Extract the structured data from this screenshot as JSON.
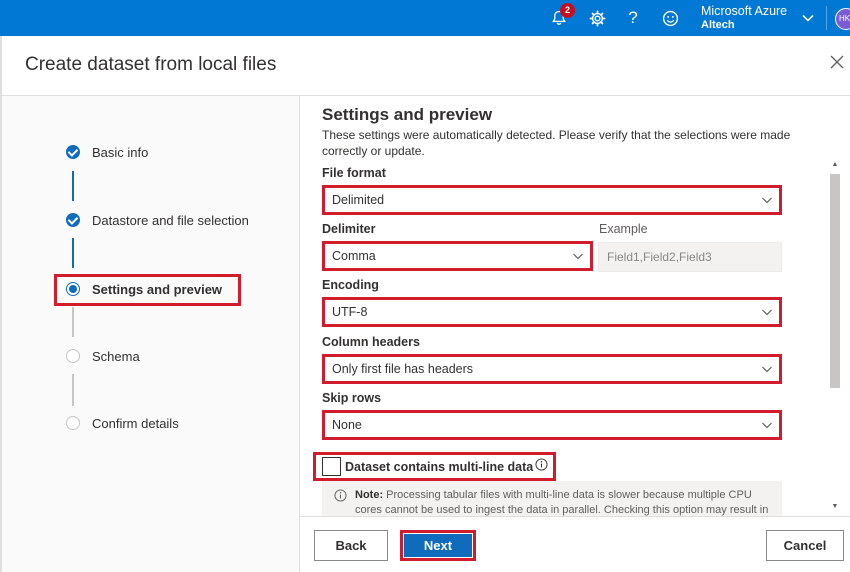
{
  "topbar": {
    "notification_count": "2",
    "account_name": "Microsoft Azure",
    "account_org": "Altech",
    "avatar_initials": "HK",
    "icons": [
      "bell-icon",
      "gear-icon",
      "help-icon",
      "feedback-icon",
      "chevron-down-icon"
    ]
  },
  "dialog": {
    "title": "Create dataset from local files"
  },
  "steps": [
    {
      "label": "Basic info",
      "state": "done"
    },
    {
      "label": "Datastore and file selection",
      "state": "done"
    },
    {
      "label": "Settings and preview",
      "state": "current"
    },
    {
      "label": "Schema",
      "state": "todo"
    },
    {
      "label": "Confirm details",
      "state": "todo"
    }
  ],
  "settings": {
    "title": "Settings and preview",
    "description": "These settings were automatically detected. Please verify that the selections were made correctly or update.",
    "file_format": {
      "label": "File format",
      "value": "Delimited"
    },
    "delimiter": {
      "label": "Delimiter",
      "value": "Comma"
    },
    "example": {
      "label": "Example",
      "value": "Field1,Field2,Field3"
    },
    "encoding": {
      "label": "Encoding",
      "value": "UTF-8"
    },
    "column_headers": {
      "label": "Column headers",
      "value": "Only first file has headers"
    },
    "skip_rows": {
      "label": "Skip rows",
      "value": "None"
    },
    "multiline": {
      "label": "Dataset contains multi-line data",
      "checked": false
    },
    "note": {
      "prefix": "Note:",
      "text": " Processing tabular files with multi-line data is slower because multiple CPU cores cannot be used to ingest the data in parallel. Checking this option may result in"
    }
  },
  "footer": {
    "back_label": "Back",
    "next_label": "Next",
    "cancel_label": "Cancel"
  },
  "colors": {
    "azure_blue": "#0078d4",
    "primary_button": "#0f6cbd",
    "highlight_red": "#d01c2c"
  }
}
